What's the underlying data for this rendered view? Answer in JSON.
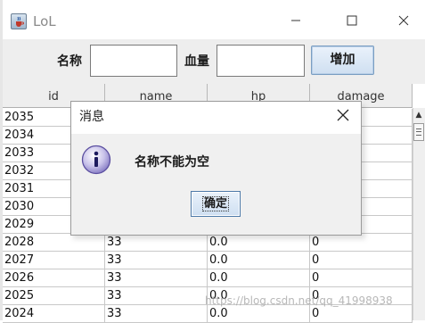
{
  "window": {
    "title": "LoL"
  },
  "toolbar": {
    "name_label": "名称",
    "name_value": "",
    "hp_label": "血量",
    "hp_value": "",
    "add_button": "增加"
  },
  "table": {
    "columns": [
      "id",
      "name",
      "hp",
      "damage"
    ],
    "rows": [
      [
        "2035",
        "",
        "",
        ""
      ],
      [
        "2034",
        "",
        "",
        ""
      ],
      [
        "2033",
        "",
        "",
        ""
      ],
      [
        "2032",
        "",
        "",
        ""
      ],
      [
        "2031",
        "",
        "",
        ""
      ],
      [
        "2030",
        "",
        "",
        ""
      ],
      [
        "2029",
        "",
        "",
        ""
      ],
      [
        "2028",
        "33",
        "0.0",
        "0"
      ],
      [
        "2027",
        "33",
        "0.0",
        "0"
      ],
      [
        "2026",
        "33",
        "0.0",
        "0"
      ],
      [
        "2025",
        "33",
        "0.0",
        "0"
      ],
      [
        "2024",
        "33",
        "0.0",
        "0"
      ]
    ]
  },
  "dialog": {
    "title": "消息",
    "message": "名称不能为空",
    "ok_button": "确定"
  },
  "watermark": "https://blog.csdn.net/qq_41998938",
  "icons": {
    "app": "java-cup-icon",
    "info": "info-icon",
    "close": "close-icon"
  }
}
